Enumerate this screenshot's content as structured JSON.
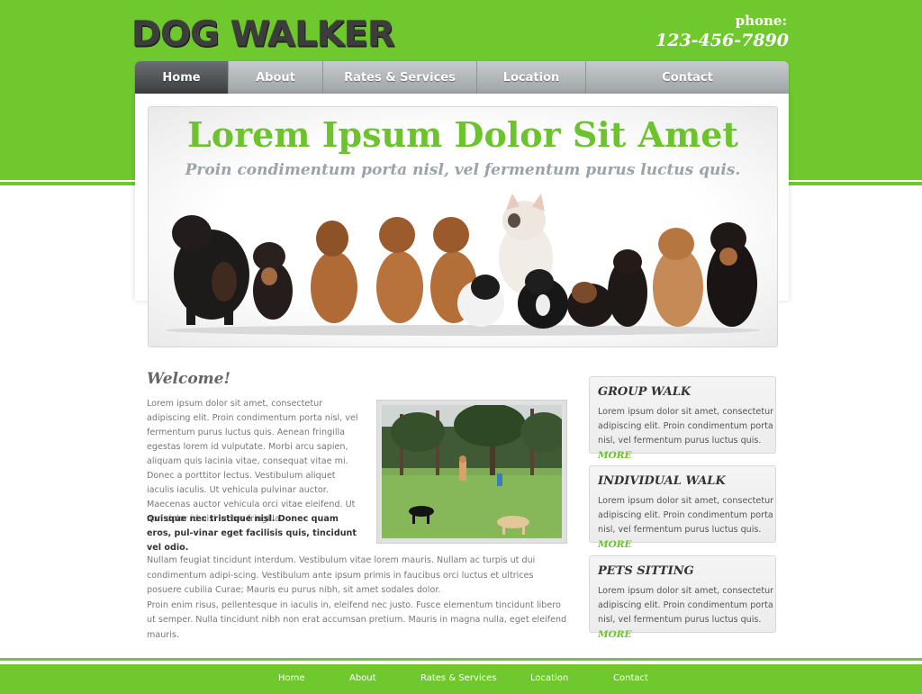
{
  "header": {
    "logo_text": "DOG WALKER",
    "phone_label": "phone:",
    "phone_number": "123-456-7890"
  },
  "nav": {
    "items": [
      {
        "label": "Home",
        "active": true
      },
      {
        "label": "About",
        "active": false
      },
      {
        "label": "Rates & Services",
        "active": false
      },
      {
        "label": "Location",
        "active": false
      },
      {
        "label": "Contact",
        "active": false
      }
    ]
  },
  "hero": {
    "title": "Lorem Ipsum Dolor Sit Amet",
    "subtitle": "Proin condimentum porta nisl, vel fermentum purus luctus quis."
  },
  "welcome": {
    "heading": "Welcome!",
    "intro": "Lorem ipsum dolor sit amet, consectetur adipiscing elit. Proin condimentum porta nisl, vel fermentum purus luctus quis. Aenean fringilla egestas lorem id vulputate. Morbi arcu sapien, aliquam quis lacinia vitae, consequat vitae mi. Donec a porttitor lectus. Vestibulum aliquet iaculis iaculis. Ut vehicula pulvinar auctor. Maecenas auctor vehicula orci vitae eleifend. Ut non dolor id nisi luctus fringilla.",
    "intro_bold": "Quisque nec tristique nisl. Donec quam eros, pul-vinar eget facilisis quis, tincidunt vel odio.",
    "para2_line1": "Nullam feugiat tincidunt interdum. Vestibulum vitae lorem mauris. Nullam ac turpis ut dui condimentum adipi-scing. Vestibulum ante ipsum primis in faucibus orci luctus et ultrices posuere cubilia Curae; Mauris eu purus nibh, sit amet sodales dolor.",
    "para2_line2": "Proin enim risus, pellentesque in iaculis in, eleifend nec justo. Fusce elementum tincidunt libero ut semper. Nulla tincidunt nibh non erat accumsan pretium. Mauris in magna nulla, eget eleifend mauris."
  },
  "services": [
    {
      "title": "GROUP WALK",
      "text": "Lorem ipsum dolor sit amet, consectetur adipiscing elit. Proin condimentum porta nisl, vel fermentum purus luctus quis.",
      "more": "MORE"
    },
    {
      "title": "INDIVIDUAL WALK",
      "text": "Lorem ipsum dolor sit amet, consectetur adipiscing elit. Proin condimentum porta nisl, vel fermentum purus luctus quis.",
      "more": "MORE"
    },
    {
      "title": "PETS SITTING",
      "text": "Lorem ipsum dolor sit amet, consectetur adipiscing elit. Proin condimentum porta nisl, vel fermentum purus luctus quis.",
      "more": "MORE"
    }
  ],
  "footer": {
    "links": [
      "Home",
      "About",
      "Rates & Services",
      "Location",
      "Contact"
    ]
  },
  "colors": {
    "brand_green": "#6fc82e",
    "title_green": "#6cc32c",
    "nav_gray": "#a5abae"
  }
}
